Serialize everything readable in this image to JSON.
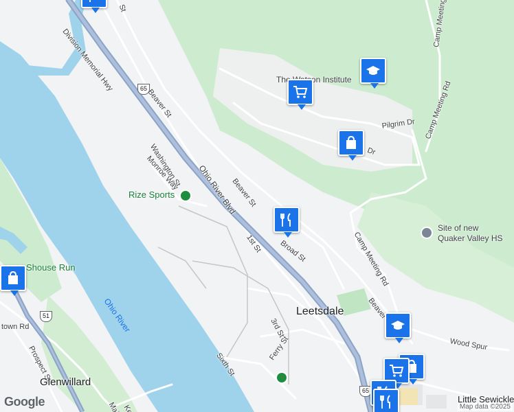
{
  "map": {
    "roads": {
      "division_memorial_hwy": "Division Memorial Hwy",
      "beaver_st_upper": "Beaver St",
      "beaver_st_mid": "Beaver St",
      "beaver_st_lower": "Beaver",
      "ohio_river_blvd": "Ohio River Blvd",
      "washington_st": "Washington St",
      "monroe_way": "Monroe Way",
      "first_st": "1st St",
      "broad_st": "Broad St",
      "pilgrim_dr": "Pilgrim Dr",
      "dr_partial": "Dr",
      "camp_meeting_rd_top": "Camp Meeting Rd",
      "camp_meeting_rd_right": "Camp Meeting Rd",
      "camp_meeting_rd_mid": "Camp Meeting Rd",
      "third_st": "3rd St",
      "ferry_st": "Ferry St",
      "sixth_st": "Sixth St",
      "wood_spur": "Wood Spur",
      "prospect_st": "Prospect St",
      "town_rd": "town Rd",
      "st_partial": "St",
      "mai_partial": "Mai",
      "ke_partial": "Ke"
    },
    "route_shields": [
      "65",
      "51",
      "65"
    ],
    "places": {
      "leetsdale": "Leetsdale",
      "glenwillard": "Glenwillard",
      "little_sewickley": "Little Sewickley"
    },
    "pois": {
      "watson_institute": "The Watson Institute",
      "rize_sports": "Rize Sports",
      "quaker_valley_hs_line1": "Site of new",
      "quaker_valley_hs_line2": "Quaker Valley HS",
      "shouse_run": "Shouse Run"
    },
    "water": {
      "ohio_river": "Ohio River"
    },
    "markers": [
      {
        "icon": "school-icon",
        "label": "school"
      },
      {
        "icon": "shopping-cart-icon",
        "label": "grocery"
      },
      {
        "icon": "shopping-bag-icon",
        "label": "shopping"
      },
      {
        "icon": "restaurant-icon",
        "label": "restaurant"
      },
      {
        "icon": "shopping-bag-icon",
        "label": "shopping"
      },
      {
        "icon": "school-icon",
        "label": "school"
      },
      {
        "icon": "shopping-bag-icon",
        "label": "shopping"
      },
      {
        "icon": "shopping-cart-icon",
        "label": "grocery"
      },
      {
        "icon": "restaurant-icon",
        "label": "restaurant"
      },
      {
        "icon": "restaurant-icon",
        "label": "restaurant"
      }
    ],
    "colors": {
      "water": "#9fd3ec",
      "park": "#cdeccf",
      "land": "#f1f3f4",
      "highway": "#8aa4c8",
      "marker": "#1a73e8"
    }
  },
  "footer": {
    "logo": "Google",
    "attribution": "Map data ©2025"
  }
}
